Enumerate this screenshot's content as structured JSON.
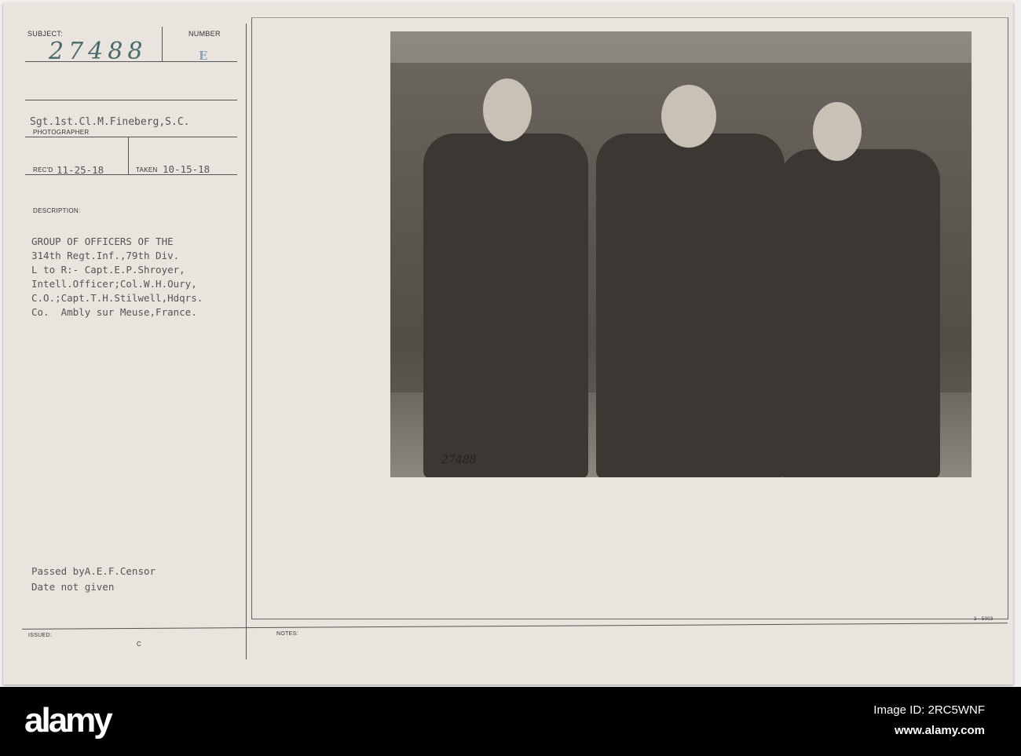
{
  "card": {
    "subject_label": "SUBJECT:",
    "subject_value": "27488",
    "number_label": "NUMBER",
    "number_value": "E",
    "photographer_value": "Sgt.1st.Cl.M.Fineberg,S.C.",
    "photographer_label": "PHOTOGRAPHER",
    "recd_label": "REC'D",
    "recd_value": "11-25-18",
    "taken_label": "TAKEN",
    "taken_value": "10-15-18",
    "description_label": "DESCRIPTION:",
    "description_lines": [
      "GROUP OF OFFICERS OF THE",
      "314th Regt.Inf.,79th Div.",
      "L to R:- Capt.E.P.Shroyer,",
      "Intell.Officer;Col.W.H.Oury,",
      "C.O.;Capt.T.H.Stilwell,Hdqrs.",
      "Co.  Ambly sur Meuse,France."
    ],
    "censor_lines": [
      "Passed byA.E.F.Censor",
      "Date not given"
    ],
    "issued_label": "ISSUED:",
    "issued_value": "C",
    "notes_label": "NOTES:",
    "form_number": "3—5003",
    "photo_stamp_number": "27488"
  },
  "footer": {
    "logo": "alamy",
    "image_id": "Image ID: 2RC5WNF",
    "url": "www.alamy.com"
  }
}
